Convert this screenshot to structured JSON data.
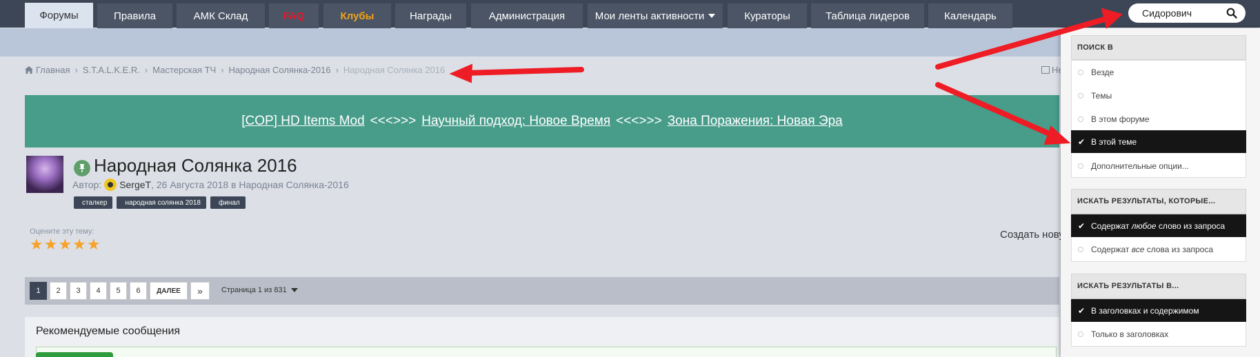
{
  "nav": {
    "tabs": [
      {
        "label": "Форумы"
      },
      {
        "label": "Правила"
      },
      {
        "label": "АМК Склад"
      },
      {
        "label": "FAQ"
      },
      {
        "label": "Клубы"
      },
      {
        "label": "Награды"
      },
      {
        "label": "Администрация"
      },
      {
        "label": "Мои ленты активности"
      },
      {
        "label": "Кураторы"
      },
      {
        "label": "Таблица лидеров"
      },
      {
        "label": "Календарь"
      }
    ],
    "active_tab": "Форумы"
  },
  "search": {
    "value": "Сидорович"
  },
  "breadcrumb": {
    "items": [
      "Главная",
      "S.T.A.L.K.E.R.",
      "Мастерская ТЧ",
      "Народная Солянка-2016",
      "Народная Солянка 2016"
    ],
    "right_text": "Не"
  },
  "banner": {
    "link1": "[COP] HD Items Mod",
    "sep1": "<<<>>>",
    "link2": "Научный подход: Новое Время",
    "sep2": "<<<>>>",
    "link3": "Зона Поражения: Новая Эра"
  },
  "topic": {
    "title": "Народная Солянка 2016",
    "author_prefix": "Автор:",
    "author": "SergeT",
    "date": ", 26 Августа 2018 в Народная Солянка-2016",
    "tags": [
      "сталкер",
      "народная солянка 2018",
      "финал"
    ],
    "rate_label": "Оцените эту тему:",
    "rating": 5,
    "stars": "★★★★★",
    "create_new": "Создать нову"
  },
  "pagination": {
    "pages": [
      "1",
      "2",
      "3",
      "4",
      "5",
      "6"
    ],
    "active_page": "1",
    "next_label": "ДАЛЕЕ",
    "last_label": "»",
    "page_of": "Страница 1 из 831"
  },
  "recommended": {
    "title": "Рекомендуемые сообщения"
  },
  "search_dropdown": {
    "section1": {
      "header": "ПОИСК В",
      "options": [
        {
          "label": "Везде",
          "selected": false
        },
        {
          "label": "Темы",
          "selected": false
        },
        {
          "label": "В этом форуме",
          "selected": false
        },
        {
          "label": "В этой теме",
          "selected": true
        },
        {
          "label": "Дополнительные опции...",
          "selected": false
        }
      ]
    },
    "section2": {
      "header": "ИСКАТЬ РЕЗУЛЬТАТЫ, КОТОРЫЕ...",
      "options": [
        {
          "pre": "Содержат ",
          "em": "любое",
          "post": " слово из запроса",
          "selected": true
        },
        {
          "pre": "Содержат ",
          "em": "все",
          "post": " слова из запроса",
          "selected": false
        }
      ]
    },
    "section3": {
      "header": "ИСКАТЬ РЕЗУЛЬТАТЫ В...",
      "options": [
        {
          "label": "В заголовках и содержимом",
          "selected": true
        },
        {
          "label": "Только в заголовках",
          "selected": false
        }
      ]
    }
  },
  "colors": {
    "nav_bg": "#3c4656",
    "banner_bg": "#479c8a",
    "annotation_arrow": "#ee1c24",
    "selected_option_bg": "#151515"
  }
}
